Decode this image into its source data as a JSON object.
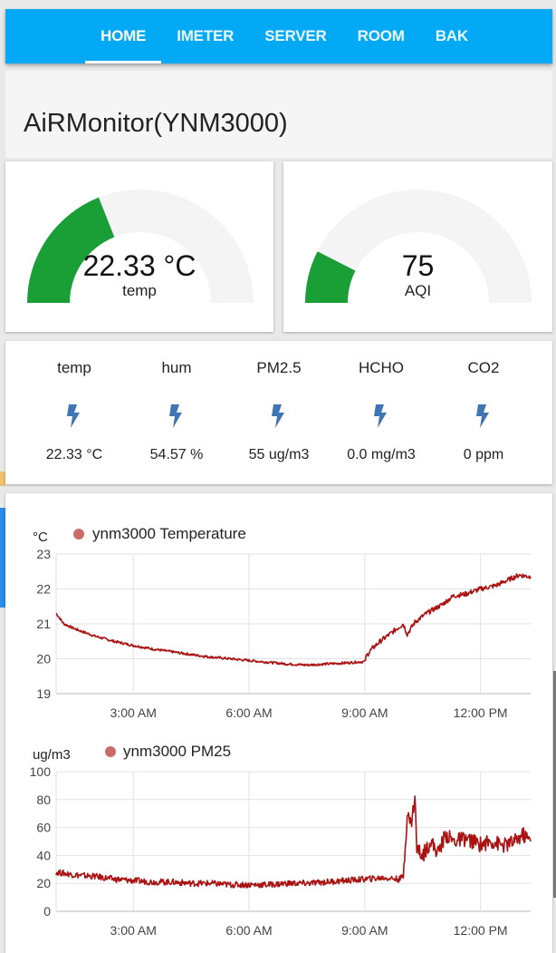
{
  "nav": {
    "tabs": [
      {
        "label": "HOME",
        "active": true
      },
      {
        "label": "IMETER",
        "active": false
      },
      {
        "label": "SERVER",
        "active": false
      },
      {
        "label": "ROOM",
        "active": false
      },
      {
        "label": "BAK",
        "active": false
      }
    ],
    "bar_color": "#03a9f4"
  },
  "page": {
    "title": "AiRMonitor(YNM3000)"
  },
  "gauges": [
    {
      "value_text": "22.33 °C",
      "label": "temp",
      "fraction": 0.38,
      "color": "#1a9f36"
    },
    {
      "value_text": "75",
      "label": "AQI",
      "fraction": 0.15,
      "color": "#1a9f36"
    }
  ],
  "sensors": [
    {
      "name": "temp",
      "icon": "lightning-icon",
      "value": "22.33 °C"
    },
    {
      "name": "hum",
      "icon": "lightning-icon",
      "value": "54.57 %"
    },
    {
      "name": "PM2.5",
      "icon": "lightning-icon",
      "value": "55 ug/m3"
    },
    {
      "name": "HCHO",
      "icon": "lightning-icon",
      "value": "0.0 mg/m3"
    },
    {
      "name": "CO2",
      "icon": "lightning-icon",
      "value": "0 ppm"
    }
  ],
  "chart_data": [
    {
      "type": "line",
      "ylabel": "°C",
      "series": [
        {
          "name": "ynm3000 Temperature",
          "color": "#aa1111"
        }
      ],
      "ylim": [
        19,
        23
      ],
      "yticks": [
        "19",
        "20",
        "21",
        "22",
        "23"
      ],
      "xlim_hours": [
        1.0,
        13.3
      ],
      "xticks": [
        {
          "label": "3:00 AM",
          "hour": 3
        },
        {
          "label": "6:00 AM",
          "hour": 6
        },
        {
          "label": "9:00 AM",
          "hour": 9
        },
        {
          "label": "12:00 PM",
          "hour": 12
        }
      ],
      "grid": true,
      "legend": "top-left",
      "points": [
        [
          1.0,
          21.3
        ],
        [
          1.2,
          21.0
        ],
        [
          1.5,
          20.85
        ],
        [
          2.0,
          20.65
        ],
        [
          2.5,
          20.5
        ],
        [
          3.0,
          20.38
        ],
        [
          3.5,
          20.28
        ],
        [
          4.0,
          20.2
        ],
        [
          4.5,
          20.12
        ],
        [
          5.0,
          20.05
        ],
        [
          5.5,
          20.0
        ],
        [
          6.0,
          19.95
        ],
        [
          6.5,
          19.9
        ],
        [
          7.0,
          19.85
        ],
        [
          7.5,
          19.82
        ],
        [
          8.0,
          19.85
        ],
        [
          8.5,
          19.88
        ],
        [
          9.0,
          19.92
        ],
        [
          9.05,
          20.1
        ],
        [
          9.2,
          20.3
        ],
        [
          9.4,
          20.5
        ],
        [
          9.7,
          20.75
        ],
        [
          10.0,
          21.0
        ],
        [
          10.1,
          20.7
        ],
        [
          10.3,
          21.05
        ],
        [
          10.6,
          21.3
        ],
        [
          11.0,
          21.55
        ],
        [
          11.3,
          21.8
        ],
        [
          11.6,
          21.85
        ],
        [
          12.0,
          22.0
        ],
        [
          12.4,
          22.1
        ],
        [
          12.7,
          22.25
        ],
        [
          13.0,
          22.4
        ],
        [
          13.3,
          22.35
        ]
      ]
    },
    {
      "type": "line",
      "ylabel": "ug/m3",
      "series": [
        {
          "name": "ynm3000 PM25",
          "color": "#aa1111"
        }
      ],
      "ylim": [
        0,
        100
      ],
      "yticks": [
        "0",
        "20",
        "40",
        "60",
        "80",
        "100"
      ],
      "xlim_hours": [
        1.0,
        13.3
      ],
      "xticks": [
        {
          "label": "3:00 AM",
          "hour": 3
        },
        {
          "label": "6:00 AM",
          "hour": 6
        },
        {
          "label": "9:00 AM",
          "hour": 9
        },
        {
          "label": "12:00 PM",
          "hour": 12
        }
      ],
      "grid": true,
      "legend": "top-left",
      "points": [
        [
          1.0,
          28
        ],
        [
          1.5,
          26
        ],
        [
          2.0,
          25
        ],
        [
          2.5,
          23
        ],
        [
          3.0,
          22
        ],
        [
          3.5,
          21
        ],
        [
          4.0,
          21
        ],
        [
          4.5,
          20
        ],
        [
          5.0,
          20
        ],
        [
          5.5,
          19
        ],
        [
          6.0,
          19
        ],
        [
          6.5,
          19
        ],
        [
          7.0,
          20
        ],
        [
          7.5,
          20
        ],
        [
          8.0,
          21
        ],
        [
          8.5,
          22
        ],
        [
          9.0,
          23
        ],
        [
          9.5,
          24
        ],
        [
          9.9,
          23
        ],
        [
          10.0,
          25
        ],
        [
          10.1,
          70
        ],
        [
          10.2,
          62
        ],
        [
          10.3,
          82
        ],
        [
          10.35,
          45
        ],
        [
          10.5,
          40
        ],
        [
          10.7,
          50
        ],
        [
          10.9,
          42
        ],
        [
          11.1,
          55
        ],
        [
          11.3,
          50
        ],
        [
          11.6,
          52
        ],
        [
          12.0,
          48
        ],
        [
          12.3,
          50
        ],
        [
          12.6,
          47
        ],
        [
          12.9,
          50
        ],
        [
          13.1,
          55
        ],
        [
          13.3,
          50
        ]
      ]
    }
  ]
}
